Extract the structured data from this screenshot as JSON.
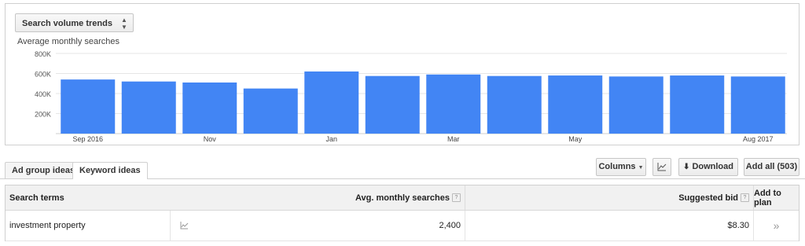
{
  "chart_panel": {
    "select_label": "Search volume trends",
    "subtitle": "Average monthly searches"
  },
  "chart_data": {
    "type": "bar",
    "title": "Average monthly searches",
    "categories": [
      "Sep 2016",
      "Oct 2016",
      "Nov 2016",
      "Dec 2016",
      "Jan 2017",
      "Feb 2017",
      "Mar 2017",
      "Apr 2017",
      "May 2017",
      "Jun 2017",
      "Jul 2017",
      "Aug 2017"
    ],
    "tick_labels": [
      "Sep 2016",
      "",
      "Nov",
      "",
      "Jan",
      "",
      "Mar",
      "",
      "May",
      "",
      "",
      "Aug 2017"
    ],
    "values": [
      540000,
      520000,
      510000,
      450000,
      620000,
      575000,
      590000,
      575000,
      580000,
      570000,
      580000,
      570000
    ],
    "y_ticks": [
      "800K",
      "600K",
      "400K",
      "200K"
    ],
    "y_tick_values": [
      800000,
      600000,
      400000,
      200000
    ],
    "ylim": [
      0,
      800000
    ],
    "bar_color": "#4285f4",
    "grid": true
  },
  "tabs": [
    {
      "label": "Ad group ideas",
      "active": false
    },
    {
      "label": "Keyword ideas",
      "active": true
    }
  ],
  "toolbar": {
    "columns_label": "Columns",
    "download_label": "Download",
    "add_all_label": "Add all (503)"
  },
  "table": {
    "headers": {
      "search_terms": "Search terms",
      "avg_searches": "Avg. monthly searches",
      "suggested_bid": "Suggested bid",
      "add_to_plan": "Add to plan",
      "help": "?"
    },
    "rows": [
      {
        "term": "investment property",
        "avg": "2,400",
        "bid": "$8.30",
        "add": "»"
      }
    ]
  }
}
